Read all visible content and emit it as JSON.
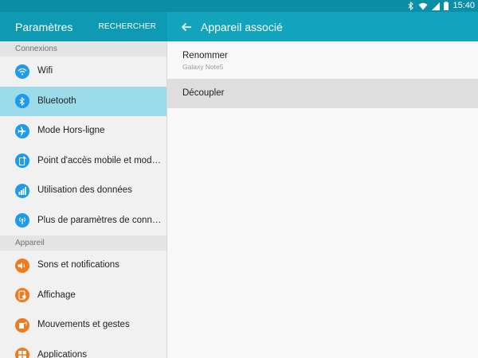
{
  "statusbar": {
    "icons": [
      "bluetooth-icon",
      "wifi-icon",
      "signal-icon",
      "battery-icon"
    ],
    "time": "15:40"
  },
  "header_left": {
    "title": "Paramètres",
    "search_label": "RECHERCHER"
  },
  "header_right": {
    "back_icon": "arrow-left-icon",
    "title": "Appareil associé"
  },
  "sidebar": {
    "sections": [
      {
        "title": "Connexions",
        "items": [
          {
            "label": "Wifi",
            "icon": "wifi-icon",
            "color": "#1e9bea",
            "active": false
          },
          {
            "label": "Bluetooth",
            "icon": "bluetooth-icon",
            "color": "#1e9bea",
            "active": true
          },
          {
            "label": "Mode Hors-ligne",
            "icon": "airplane-icon",
            "color": "#1e9bea",
            "active": false
          },
          {
            "label": "Point d'accès mobile et modem",
            "icon": "hotspot-icon",
            "color": "#1e9bea",
            "active": false
          },
          {
            "label": "Utilisation des données",
            "icon": "data-usage-icon",
            "color": "#1e9bea",
            "active": false
          },
          {
            "label": "Plus de paramètres de connex..",
            "icon": "more-connections-icon",
            "color": "#1e9bea",
            "active": false
          }
        ]
      },
      {
        "title": "Appareil",
        "items": [
          {
            "label": "Sons et notifications",
            "icon": "sound-icon",
            "color": "#f07a1c",
            "active": false
          },
          {
            "label": "Affichage",
            "icon": "display-icon",
            "color": "#f07a1c",
            "active": false
          },
          {
            "label": "Mouvements et gestes",
            "icon": "motion-icon",
            "color": "#f07a1c",
            "active": false
          },
          {
            "label": "Applications",
            "icon": "apps-icon",
            "color": "#f07a1c",
            "active": false
          }
        ]
      }
    ]
  },
  "detail": {
    "rename": {
      "label": "Renommer",
      "sublabel": "Galaxy Note5"
    },
    "unpair": {
      "label": "Découpler"
    }
  },
  "colors": {
    "statusbar": "#0a8fa6",
    "header_left": "#0e9ab3",
    "header_right": "#12a4bd",
    "active_item": "#9cdbea",
    "blue_icon": "#1e9bea",
    "orange_icon": "#f07a1c"
  }
}
